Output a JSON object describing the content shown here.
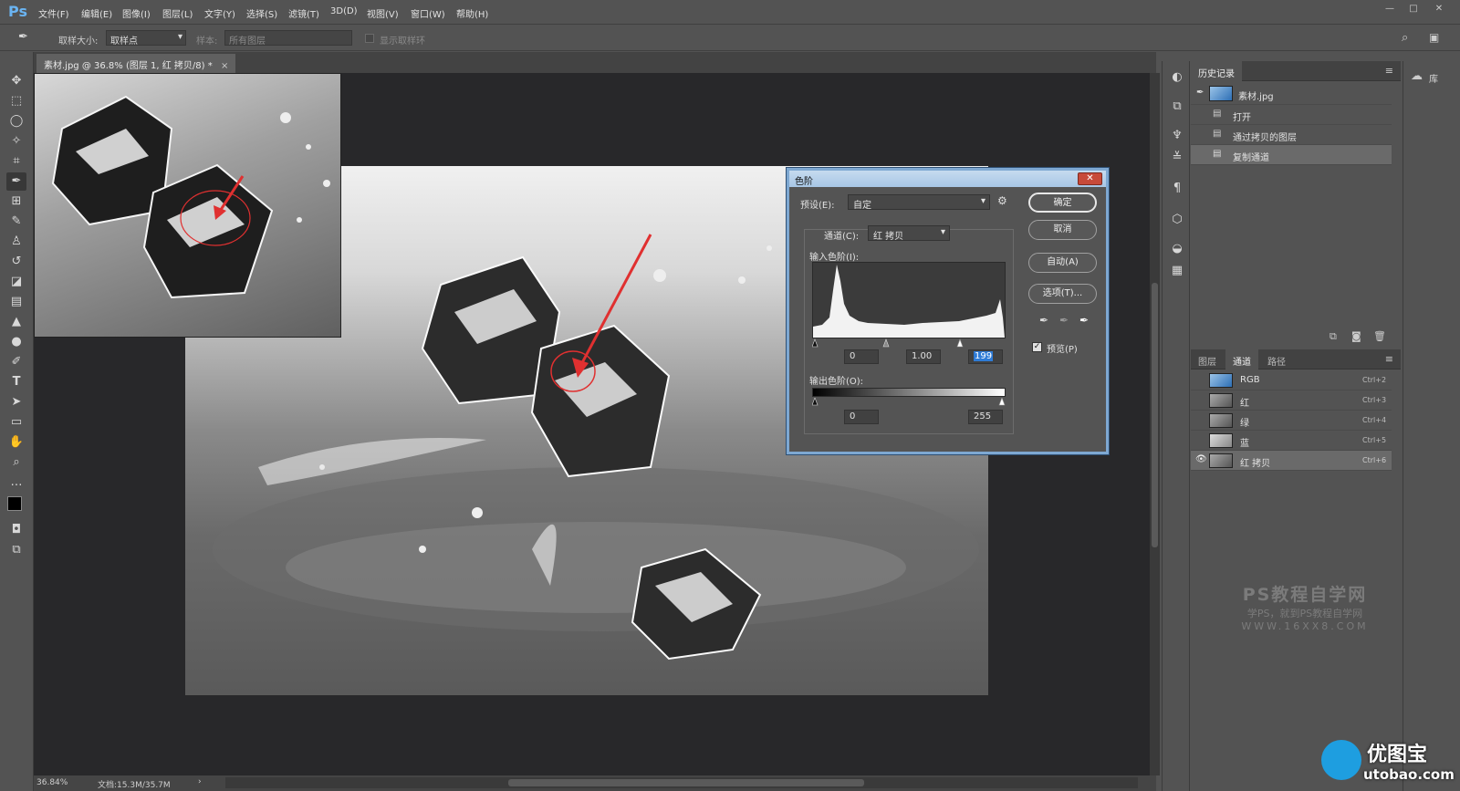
{
  "app": {
    "logo": "Ps",
    "menu": [
      "文件(F)",
      "编辑(E)",
      "图像(I)",
      "图层(L)",
      "文字(Y)",
      "选择(S)",
      "滤镜(T)",
      "3D(D)",
      "视图(V)",
      "窗口(W)",
      "帮助(H)"
    ]
  },
  "options": {
    "sample_size_label": "取样大小:",
    "sample_size_value": "取样点",
    "sample_label": "样本:",
    "sample_value": "所有图层",
    "show_ring_label": "显示取样环"
  },
  "document": {
    "tab_title": "素材.jpg @ 36.8% (图层 1, 红 拷贝/8) *",
    "zoom": "36.84%",
    "doc_size": "文档:15.3M/35.7M"
  },
  "dialog": {
    "title": "色阶",
    "close": "✕",
    "preset_label": "预设(E):",
    "preset_value": "自定",
    "channel_label": "通道(C):",
    "channel_value": "红 拷贝",
    "input_label": "输入色阶(I):",
    "input_black": "0",
    "input_gamma": "1.00",
    "input_white": "199",
    "output_label": "输出色阶(O):",
    "output_black": "0",
    "output_white": "255",
    "ok": "确定",
    "cancel": "取消",
    "auto": "自动(A)",
    "options": "选项(T)...",
    "preview_label": "预览(P)",
    "preview_checked": true
  },
  "history": {
    "tab": "历史记录",
    "snapshot": "素材.jpg",
    "items": [
      "打开",
      "通过拷贝的图层",
      "复制通道"
    ]
  },
  "channels": {
    "tabs": [
      "图层",
      "通道",
      "路径"
    ],
    "rows": [
      {
        "name": "RGB",
        "shortcut": "Ctrl+2"
      },
      {
        "name": "红",
        "shortcut": "Ctrl+3"
      },
      {
        "name": "绿",
        "shortcut": "Ctrl+4"
      },
      {
        "name": "蓝",
        "shortcut": "Ctrl+5"
      },
      {
        "name": "红 拷贝",
        "shortcut": "Ctrl+6"
      }
    ]
  },
  "library": {
    "label": "库"
  },
  "watermark": {
    "line1": "PS教程自学网",
    "line2": "学PS，就到PS教程自学网",
    "line3": "WWW.16XX8.COM"
  },
  "brand": {
    "name": "优图宝",
    "url": "utobao.com"
  },
  "colors": {
    "accent": "#7ea8d2",
    "selection": "#2e7bd6",
    "arrow": "#e03030"
  }
}
